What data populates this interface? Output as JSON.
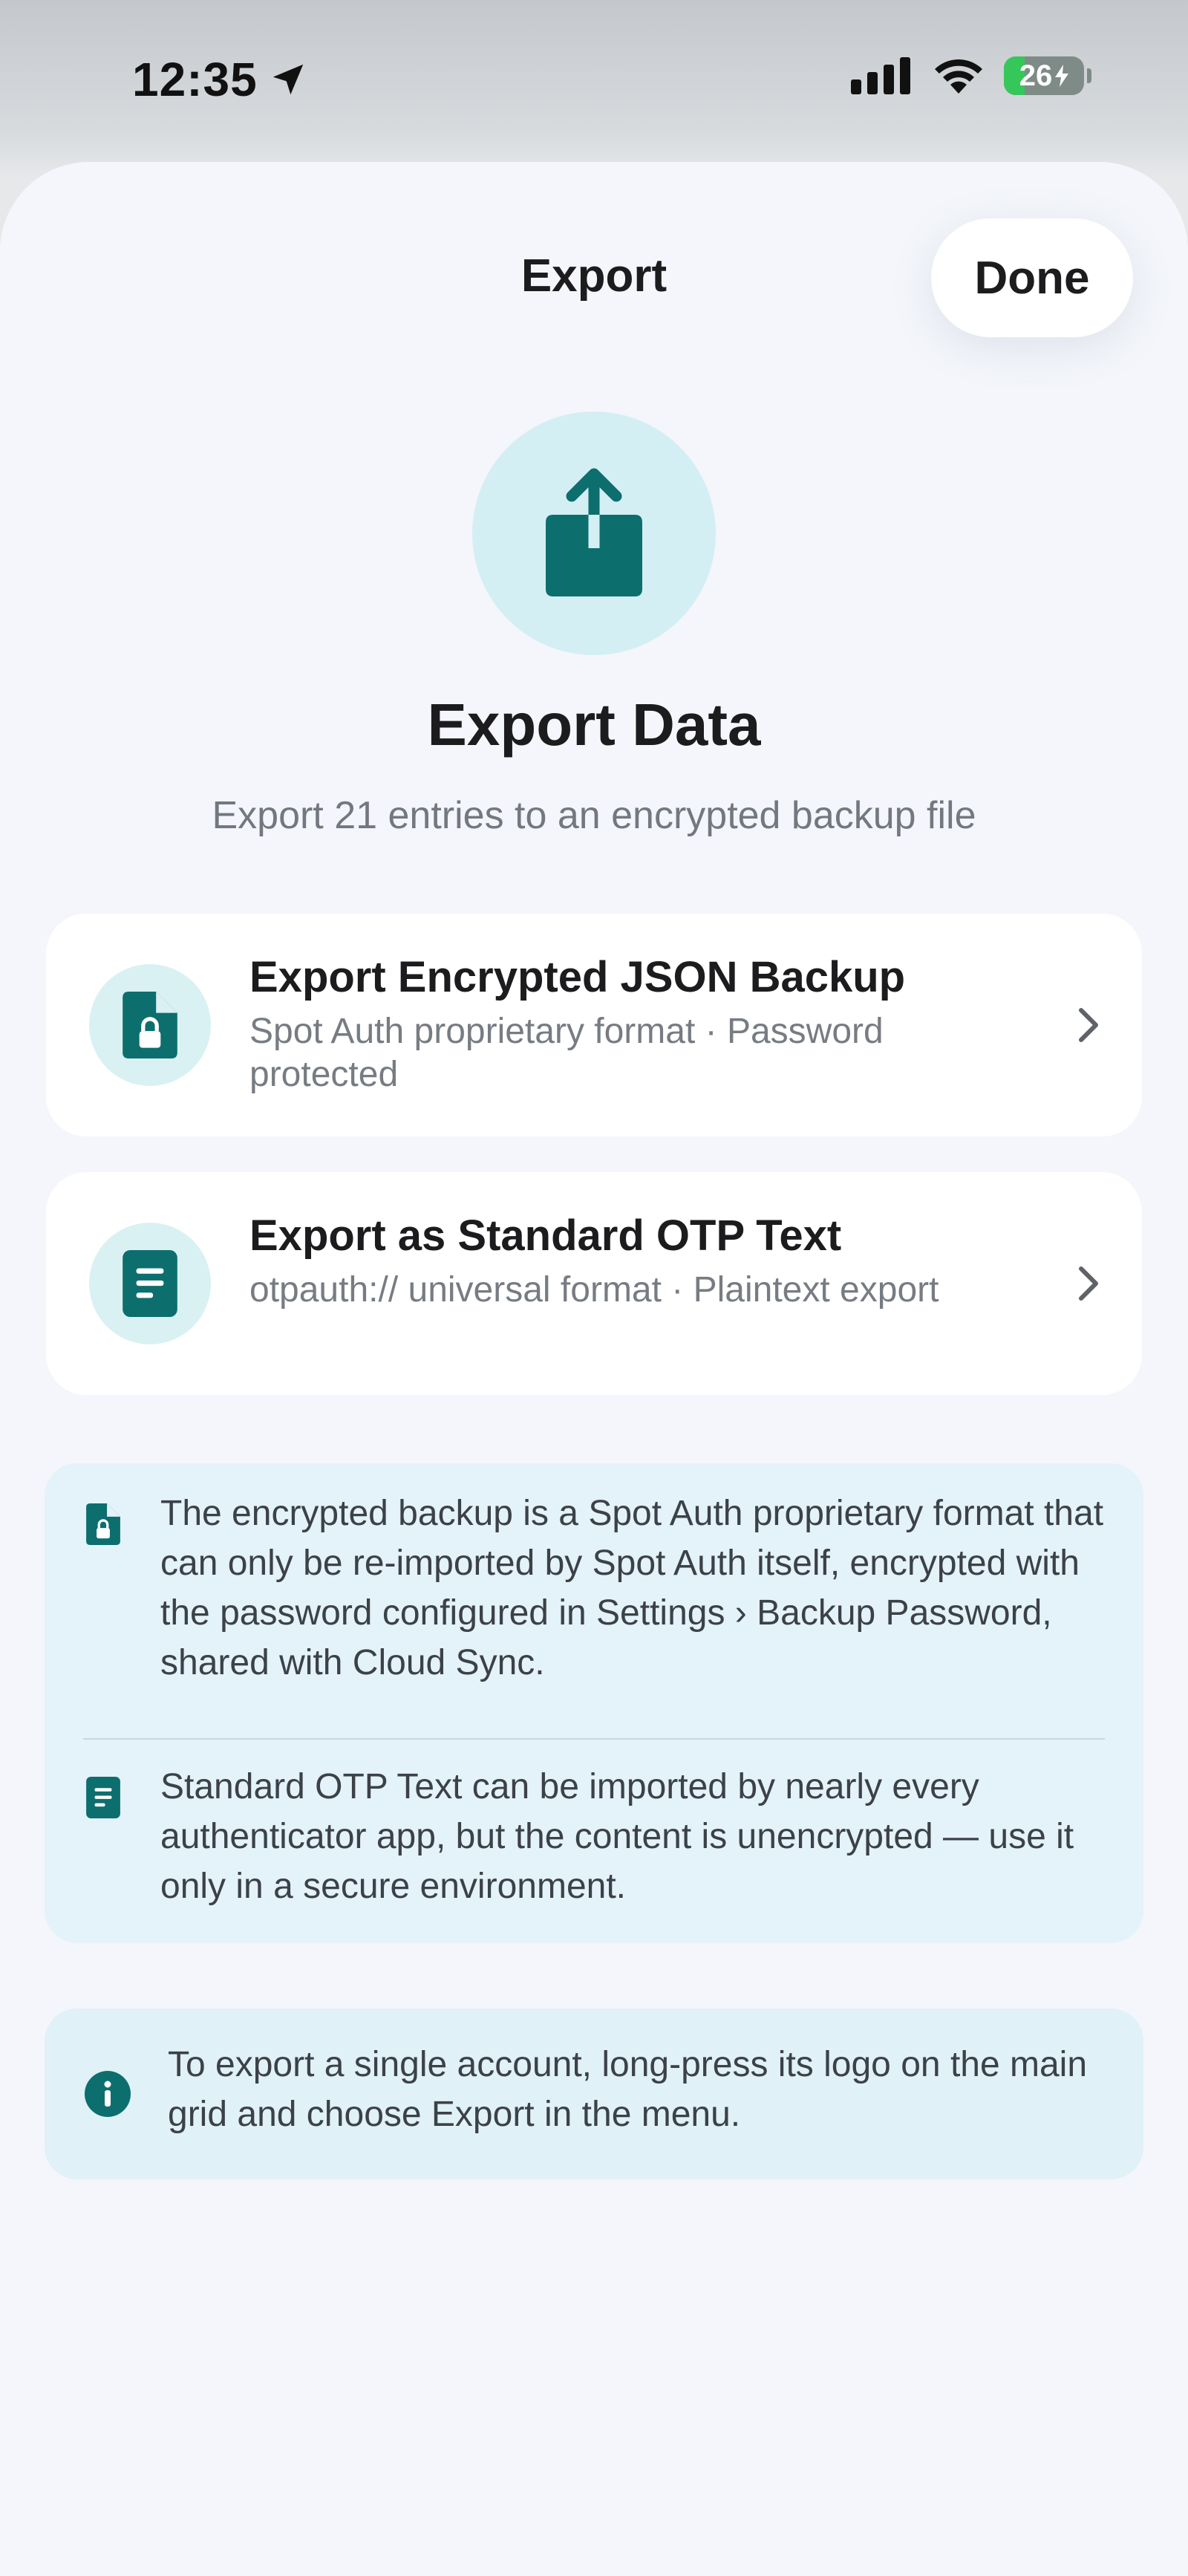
{
  "status_bar": {
    "time": "12:35",
    "battery_level": "26",
    "battery_fraction": 0.26,
    "icons": [
      "location-arrow-icon",
      "signal-icon",
      "wifi-icon",
      "battery-charging-icon"
    ]
  },
  "sheet": {
    "title": "Export",
    "done_label": "Done"
  },
  "hero": {
    "icon": "share-upload-icon",
    "title": "Export Data",
    "subtitle": "Export 21 entries to an encrypted backup file"
  },
  "options": [
    {
      "icon": "locked-file-icon",
      "title": "Export Encrypted JSON Backup",
      "description": "Spot Auth proprietary format · Password protected"
    },
    {
      "icon": "text-document-icon",
      "title": "Export as Standard OTP Text",
      "description": "otpauth:// universal format · Plaintext export"
    }
  ],
  "info": {
    "encrypted_note": "The encrypted backup is a Spot Auth proprietary format that can only be re-imported by Spot Auth itself, encrypted with the password configured in Settings › Backup Password, shared with Cloud Sync.",
    "plaintext_note": "Standard OTP Text can be imported by nearly every authenticator app, but the content is unencrypted — use it only in a secure environment."
  },
  "tip": {
    "text": "To export a single account, long-press its logo on the main grid and choose Export in the menu."
  },
  "colors": {
    "accent": "#0d6e6e",
    "icon_bg": "#d4eff4",
    "info_bg": "#e4f2f9",
    "battery_green": "#35c759"
  }
}
